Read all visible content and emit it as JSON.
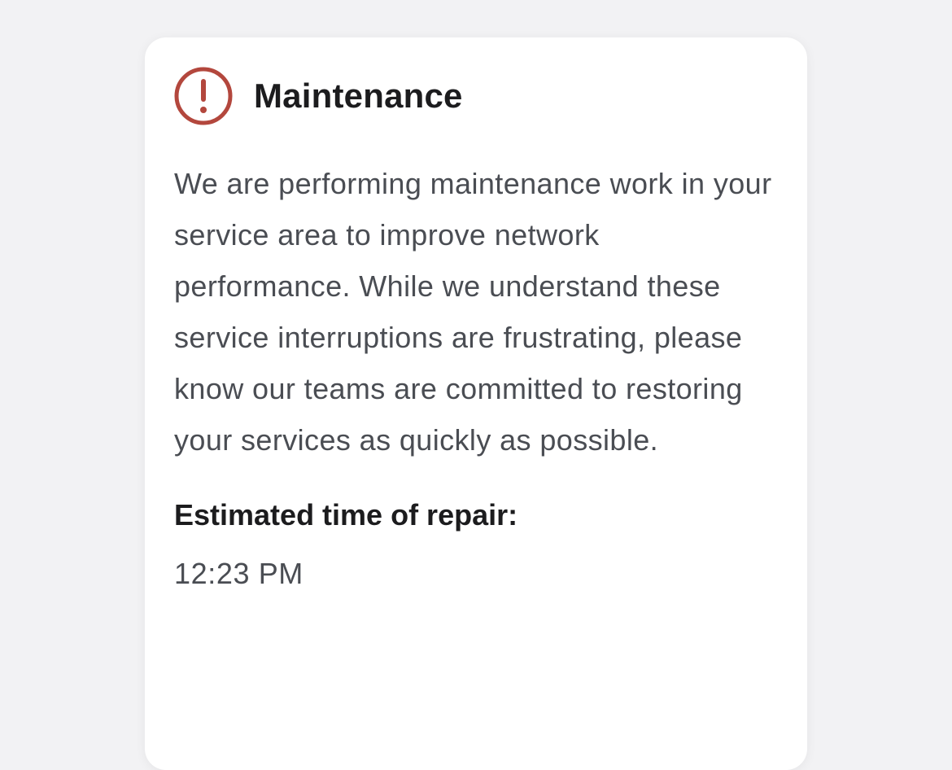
{
  "card": {
    "icon": "exclamation-circle-icon",
    "title": "Maintenance",
    "message": "We are performing maintenance work in your service area to improve network performance. While we understand these service interruptions are frustrating, please know our teams are committed to restoring your services as quickly as possible.",
    "repair_label": "Estimated time of repair:",
    "repair_time": "12:23 PM"
  },
  "colors": {
    "alert_red": "#b3473d",
    "heading": "#1c1c1e",
    "body_text": "#4a4d53",
    "card_background": "#ffffff",
    "page_background": "#f2f2f4"
  }
}
